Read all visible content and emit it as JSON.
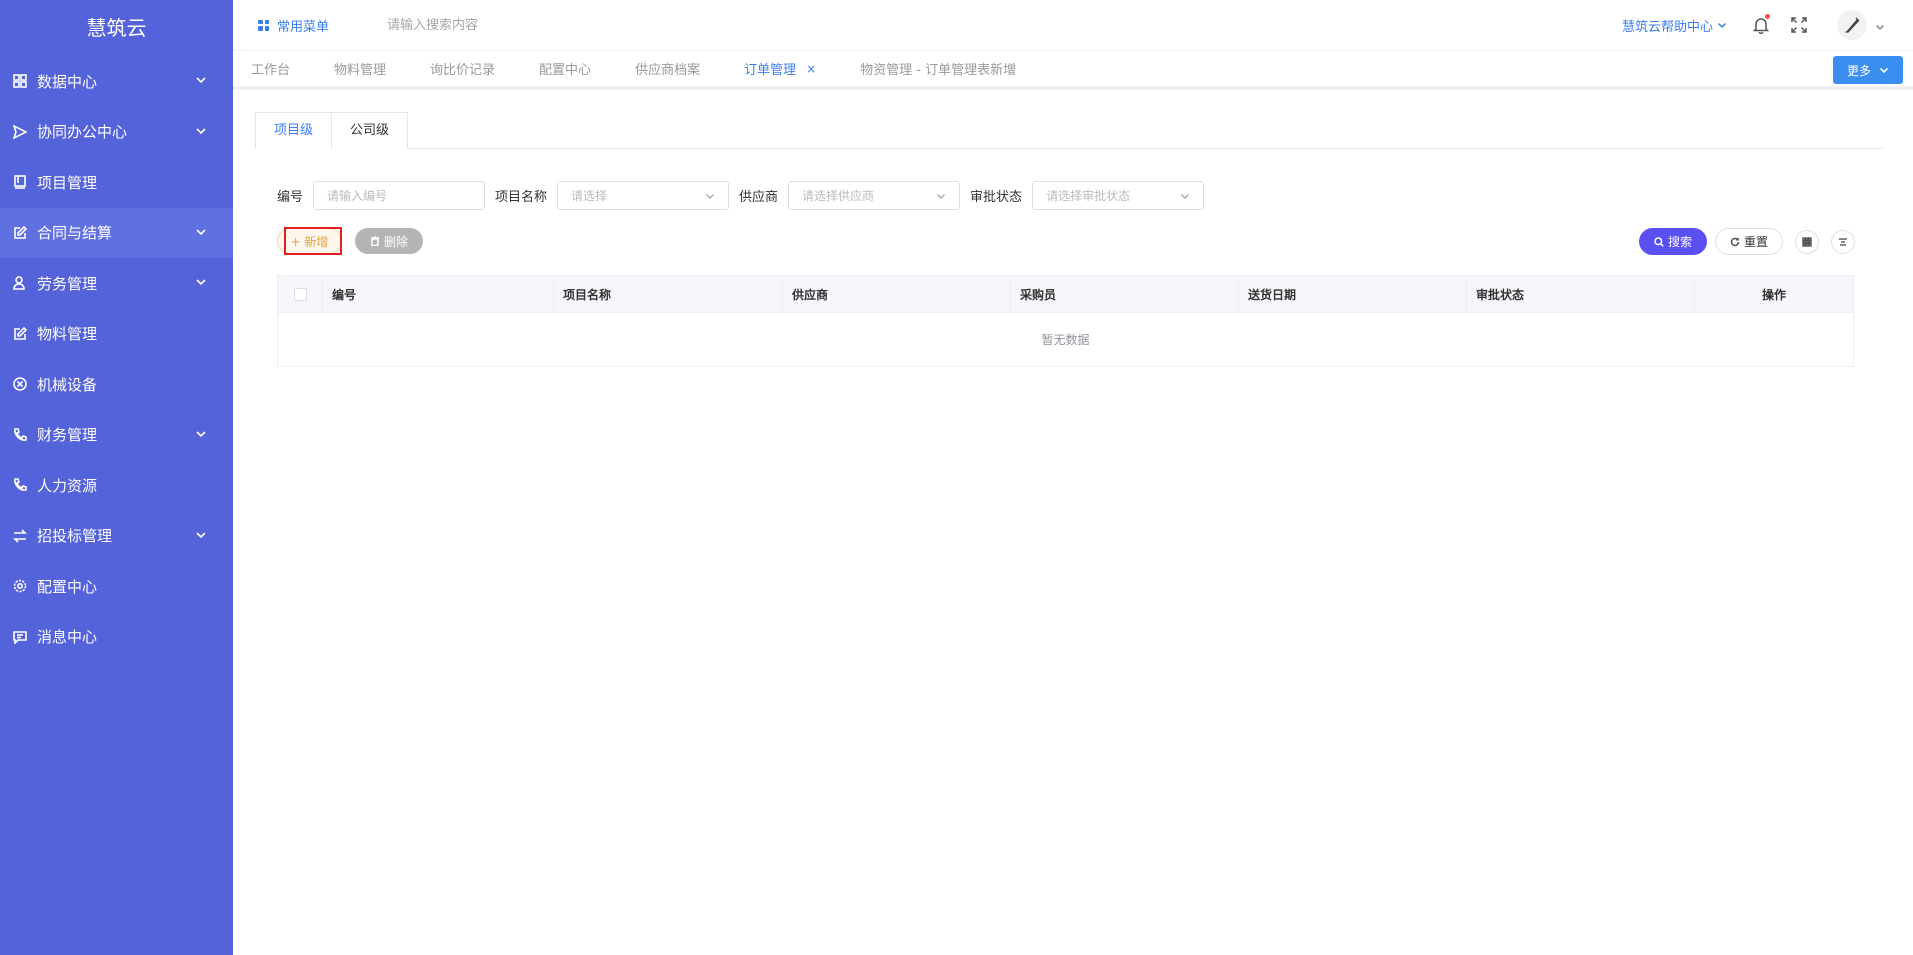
{
  "sidebar": {
    "logo": "慧筑云",
    "items": [
      {
        "label": "数据中心",
        "icon": "grid-icon",
        "has_children": true
      },
      {
        "label": "协同办公中心",
        "icon": "send-icon",
        "has_children": true
      },
      {
        "label": "项目管理",
        "icon": "book-icon",
        "has_children": false
      },
      {
        "label": "合同与结算",
        "icon": "edit-icon",
        "has_children": true,
        "active": true
      },
      {
        "label": "劳务管理",
        "icon": "user-icon",
        "has_children": true
      },
      {
        "label": "物料管理",
        "icon": "edit-icon",
        "has_children": false
      },
      {
        "label": "机械设备",
        "icon": "circle-x-icon",
        "has_children": false
      },
      {
        "label": "财务管理",
        "icon": "phone-icon",
        "has_children": true
      },
      {
        "label": "人力资源",
        "icon": "phone-icon",
        "has_children": false
      },
      {
        "label": "招投标管理",
        "icon": "exchange-icon",
        "has_children": true
      },
      {
        "label": "配置中心",
        "icon": "gear-icon",
        "has_children": false
      },
      {
        "label": "消息中心",
        "icon": "message-icon",
        "has_children": false
      }
    ]
  },
  "header": {
    "favorites": "常用菜单",
    "search_placeholder": "请输入搜索内容",
    "help": "慧筑云帮助中心"
  },
  "tabs": {
    "items": [
      {
        "label": "工作台",
        "active": false
      },
      {
        "label": "物料管理",
        "active": false
      },
      {
        "label": "询比价记录",
        "active": false
      },
      {
        "label": "配置中心",
        "active": false
      },
      {
        "label": "供应商档案",
        "active": false
      },
      {
        "label": "订单管理",
        "active": true,
        "close": "×"
      },
      {
        "label": "物资管理 - 订单管理表新增",
        "active": false
      }
    ],
    "more": "更多"
  },
  "level_tabs": {
    "project": "项目级",
    "company": "公司级"
  },
  "filter": {
    "code_label": "编号",
    "code_placeholder": "请输入编号",
    "project_label": "项目名称",
    "project_placeholder": "请选择",
    "supplier_label": "供应商",
    "supplier_placeholder": "请选择供应商",
    "status_label": "审批状态",
    "status_placeholder": "请选择审批状态"
  },
  "actions": {
    "add": "+ 新增",
    "delete": "删除",
    "search": "搜索",
    "reset": "重置"
  },
  "table": {
    "columns": [
      "编号",
      "项目名称",
      "供应商",
      "采购员",
      "送货日期",
      "审批状态",
      "操作"
    ],
    "empty_text": "暂无数据"
  },
  "colors": {
    "sidebar_bg": "#5463da",
    "accent": "#3a7df0",
    "search_button": "#5a4ff0",
    "add_button_text": "#e6a23c",
    "highlight_box": "#e02020"
  }
}
